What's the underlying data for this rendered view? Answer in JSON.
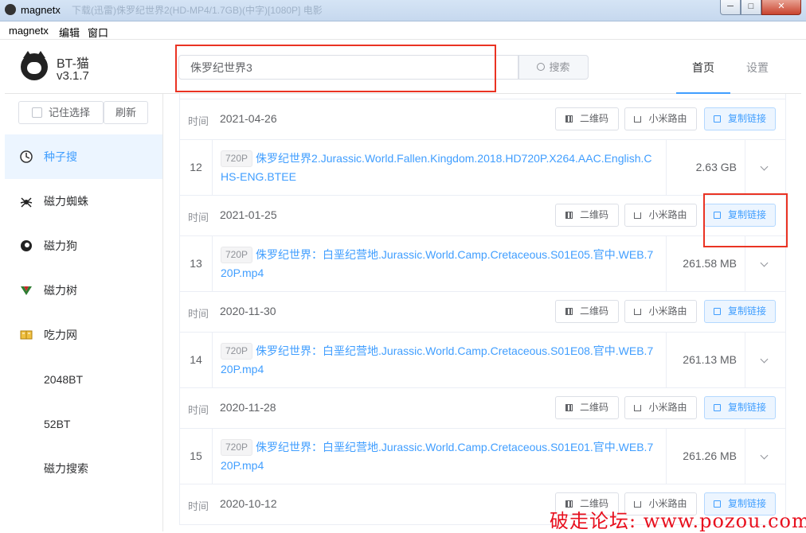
{
  "window": {
    "title": "magnetx",
    "ghost_title": "下载(迅雷)侏罗纪世界2(HD-MP4/1.7GB)(中字)[1080P]  电影",
    "buttons": {
      "minimize": "─",
      "maximize": "□",
      "close": "✕"
    }
  },
  "menu": [
    "magnetx",
    "编辑",
    "窗口"
  ],
  "brand": {
    "name": "BT-猫",
    "version": "v3.1.7"
  },
  "search": {
    "value": "侏罗纪世界3",
    "button_label": "搜索"
  },
  "tabs": [
    {
      "label": "首页",
      "active": true
    },
    {
      "label": "设置",
      "active": false
    }
  ],
  "sidebar": {
    "remember_label": "记住选择",
    "refresh_label": "刷新",
    "items": [
      {
        "label": "种子搜",
        "icon": "seed-search-icon",
        "active": true
      },
      {
        "label": "磁力蜘蛛",
        "icon": "spider-icon",
        "active": false
      },
      {
        "label": "磁力狗",
        "icon": "dog-icon",
        "active": false
      },
      {
        "label": "磁力树",
        "icon": "tree-icon",
        "active": false
      },
      {
        "label": "吃力网",
        "icon": "book-icon",
        "active": false
      },
      {
        "label": "2048BT",
        "icon": "",
        "active": false
      },
      {
        "label": "52BT",
        "icon": "",
        "active": false
      },
      {
        "label": "磁力搜索",
        "icon": "",
        "active": false
      }
    ]
  },
  "actions": {
    "qr": "二维码",
    "mi": "小米路由",
    "copy": "复制链接"
  },
  "time_label": "时间",
  "results": [
    {
      "date": "2021-04-26",
      "index": "12",
      "tag": "720P",
      "name": "侏罗纪世界2.Jurassic.World.Fallen.Kingdom.2018.HD720P.X264.AAC.English.CHS-ENG.BTEE",
      "size": "2.63 GB"
    },
    {
      "date": "2021-01-25",
      "index": "13",
      "tag": "720P",
      "name": "侏罗纪世界：白垩纪营地.Jurassic.World.Camp.Cretaceous.S01E05.官中.WEB.720P.mp4",
      "size": "261.58 MB"
    },
    {
      "date": "2020-11-30",
      "index": "14",
      "tag": "720P",
      "name": "侏罗纪世界：白垩纪营地.Jurassic.World.Camp.Cretaceous.S01E08.官中.WEB.720P.mp4",
      "size": "261.13 MB"
    },
    {
      "date": "2020-11-28",
      "index": "15",
      "tag": "720P",
      "name": "侏罗纪世界：白垩纪营地.Jurassic.World.Camp.Cretaceous.S01E01.官中.WEB.720P.mp4",
      "size": "261.26 MB"
    }
  ],
  "last_date": "2020-10-12",
  "watermark": "破走论坛: www.pozou.com"
}
